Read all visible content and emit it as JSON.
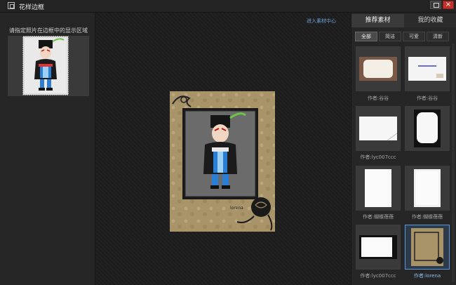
{
  "window": {
    "title": "花样边框",
    "maximize_symbol": "",
    "close_symbol": "×"
  },
  "left_panel": {
    "label": "请指定照片在边框中的显示区域"
  },
  "center": {
    "link_text": "进入素材中心",
    "frame_signature": "lorena"
  },
  "right_panel": {
    "tabs": [
      "推荐素材",
      "我的收藏"
    ],
    "filters": [
      "全部",
      "简洁",
      "可爱",
      "清新"
    ],
    "thumbnails": [
      {
        "caption": "作者:谷谷"
      },
      {
        "caption": "作者:谷谷"
      },
      {
        "caption": "作者:lyc007ccc"
      },
      {
        "caption": ""
      },
      {
        "caption": "作者:蝴蝶蓓蓓"
      },
      {
        "caption": "作者:蝴蝶蓓蓓"
      },
      {
        "caption": "作者:lyc007ccc"
      },
      {
        "caption": "作者:lorena"
      }
    ]
  },
  "colors": {
    "accent_blue": "#5b9ae0",
    "link_blue": "#6fa6df",
    "close_red": "#c3322a",
    "frame_tan": "#a89468"
  }
}
